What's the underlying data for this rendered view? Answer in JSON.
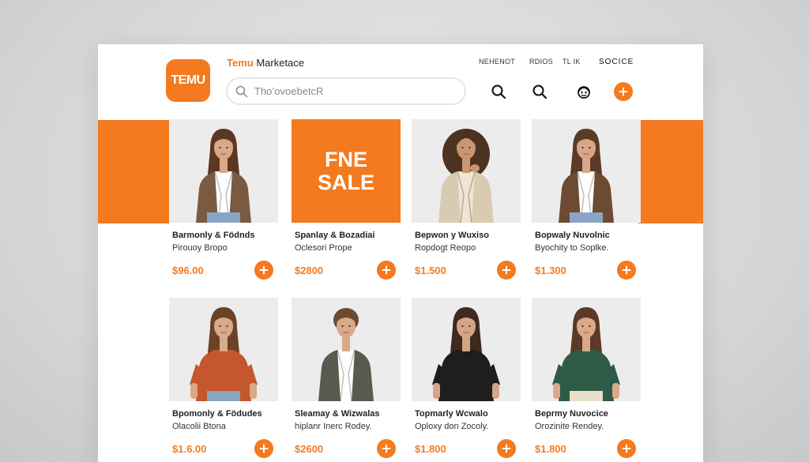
{
  "window": {
    "brand_prefix": "Temu",
    "brand_suffix": " Marketace"
  },
  "logo": {
    "text": "TEMU"
  },
  "search": {
    "placeholder": "Tho’ovoebetcR"
  },
  "nav": {
    "items": [
      "NEHENOT",
      "RDIOS",
      "TL IK",
      "SOCICE"
    ]
  },
  "colors": {
    "accent": "#f47a1f",
    "text": "#222222"
  },
  "header_icons": [
    "search-icon",
    "search-icon",
    "support-icon",
    "add-icon"
  ],
  "promo": {
    "line1": "FNE",
    "line2": "SALE"
  },
  "products": [
    {
      "title": "Barmonly & Födnds",
      "subtitle": "Pirouoy Bropo",
      "price": "$96.00",
      "figure": "woman-blazer",
      "top_color": "#ffffff",
      "outer_color": "#7a5a43",
      "skin": "#d9a988",
      "hair": "#5a3825"
    },
    {
      "title": "Spanlay & Bozadiai",
      "subtitle": "Oclesori Prope",
      "price": "$2800",
      "figure": "promo"
    },
    {
      "title": "Bepwon y Wuxiso",
      "subtitle": "Ropdogt Reopo",
      "price": "$1.500",
      "figure": "woman-curly",
      "top_color": "#efe5d3",
      "outer_color": "#d9cbb2",
      "skin": "#c99573",
      "hair": "#4d3222"
    },
    {
      "title": "Bopwaly Nuvolnic",
      "subtitle": "Byochity to Soplke.",
      "price": "$1.300",
      "figure": "woman-jacket",
      "top_color": "#ffffff",
      "outer_color": "#6d4a32",
      "skin": "#d8a787",
      "hair": "#5b3a26"
    },
    {
      "title": "Bpomonly & Födudes",
      "subtitle": "Olacolii Btona",
      "price": "$1.6.00",
      "figure": "woman-tee",
      "top_color": "#c4572b",
      "outer_color": "#c4572b",
      "skin": "#d9a988",
      "hair": "#6b4228"
    },
    {
      "title": "Sleamay & Wizwalas",
      "subtitle": "hiplanr Inerc Rodey.",
      "price": "$2600",
      "figure": "man-shirt",
      "top_color": "#ffffff",
      "outer_color": "#5a5a4e",
      "skin": "#d9a988",
      "hair": "#6b4a30"
    },
    {
      "title": "Topmarly Wcwalo",
      "subtitle": "Oploxy don Zocoly.",
      "price": "$1.800",
      "figure": "woman-black",
      "top_color": "#1e1e1e",
      "outer_color": "#1e1e1e",
      "skin": "#d6a585",
      "hair": "#3e2a1f"
    },
    {
      "title": "Beprmy Nuvocice",
      "subtitle": "Orozinite Rendey.",
      "price": "$1.800",
      "figure": "woman-green",
      "top_color": "#2d5b47",
      "outer_color": "#2d5b47",
      "skin": "#d9a988",
      "hair": "#5a3a26"
    }
  ]
}
